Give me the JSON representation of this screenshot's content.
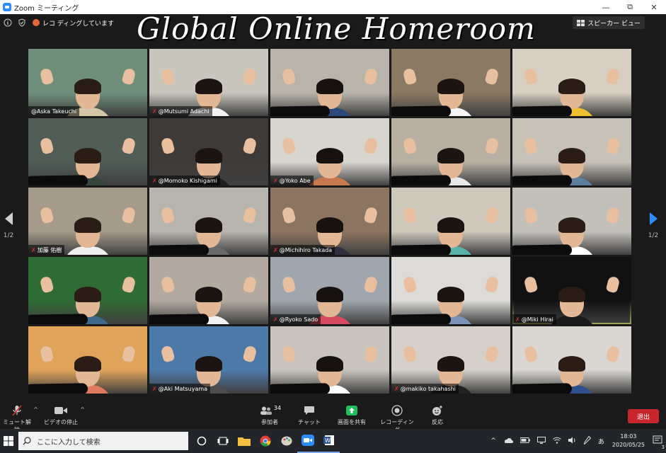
{
  "window": {
    "title": "Zoom ミーティング",
    "minimize": "—",
    "maximize": "⧉",
    "close": "✕"
  },
  "meeting_bar": {
    "recording_label": "レコ  ディングしています",
    "view_label": "スピーカー ビュー"
  },
  "banner": "Global Online Homeroom",
  "pagination": {
    "left": "1/2",
    "right": "1/2"
  },
  "participants": [
    {
      "name": "@Aska Takeuchi",
      "muted": false
    },
    {
      "name": "@Mutsumi Adachi",
      "muted": true
    },
    {
      "name": "",
      "muted": false
    },
    {
      "name": "",
      "muted": false
    },
    {
      "name": "",
      "muted": false
    },
    {
      "name": "",
      "muted": false
    },
    {
      "name": "@Momoko Kishigami",
      "muted": true
    },
    {
      "name": "@Yoko Abe",
      "muted": true
    },
    {
      "name": "",
      "muted": false
    },
    {
      "name": "",
      "muted": false
    },
    {
      "name": "加藤 佑樹",
      "muted": true
    },
    {
      "name": "",
      "muted": false
    },
    {
      "name": "@Michihiro Takada",
      "muted": true
    },
    {
      "name": "",
      "muted": false
    },
    {
      "name": "",
      "muted": false
    },
    {
      "name": "",
      "muted": false
    },
    {
      "name": "",
      "muted": false
    },
    {
      "name": "@Ryoko Sado",
      "muted": true
    },
    {
      "name": "",
      "muted": false
    },
    {
      "name": "@Miki Hirai",
      "muted": true
    },
    {
      "name": "",
      "muted": false
    },
    {
      "name": "@Aki Matsuyama",
      "muted": true
    },
    {
      "name": "",
      "muted": false
    },
    {
      "name": "@makiko takahashi",
      "muted": true
    },
    {
      "name": "",
      "muted": false
    }
  ],
  "controls": {
    "mute": "ミュート解除",
    "video": "ビデオの停止",
    "participants": "参加者",
    "participant_count": "34",
    "chat": "チャット",
    "share": "画面を共有",
    "record": "レコーディング",
    "reactions": "反応",
    "leave": "退出"
  },
  "taskbar": {
    "search_placeholder": "ここに入力して検索",
    "ime": "あ",
    "time": "18:03",
    "date": "2020/05/25",
    "notifications": "3"
  },
  "colors": {
    "share_green": "#1fbf5b",
    "leave_red": "#c8262c",
    "nav_blue": "#2d8cff",
    "active_speaker": "#d7e07a"
  }
}
